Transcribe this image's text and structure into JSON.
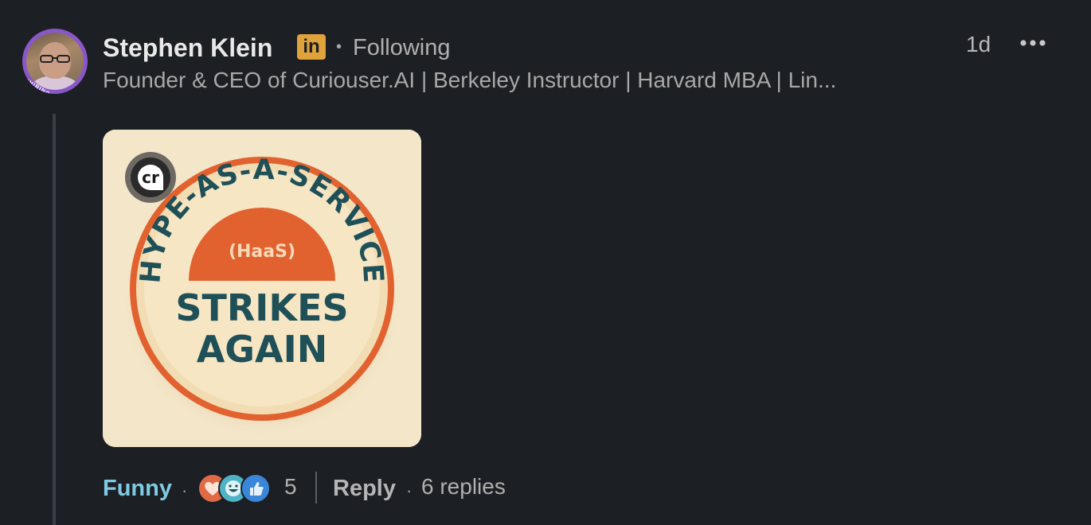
{
  "post": {
    "author_name": "Stephen Klein",
    "linkedin_badge": "in",
    "follow_status": "Following",
    "headline": "Founder & CEO of Curiouser.AI | Berkeley Instructor | Harvard MBA | Lin...",
    "timestamp": "1d",
    "more_icon": "more-horizontal-icon",
    "avatar_badge": "#HIRING"
  },
  "image": {
    "logo_text": "cr",
    "arc_text": "HYPE-AS-A-SERVICE",
    "sub_text": "(HaaS)",
    "line1": "STRIKES",
    "line2": "AGAIN"
  },
  "footer": {
    "reaction_label": "Funny",
    "reaction_icons": [
      "love-icon",
      "funny-icon",
      "like-icon"
    ],
    "reaction_count": "5",
    "reply_label": "Reply",
    "replies_count": "6 replies"
  },
  "colors": {
    "background": "#1c1f24",
    "accent_funny": "#7ecbe3",
    "linkedin_badge": "#e0a23a",
    "button_orange": "#e2622f",
    "button_text": "#1f5058",
    "button_cream": "#f6e6c4"
  }
}
